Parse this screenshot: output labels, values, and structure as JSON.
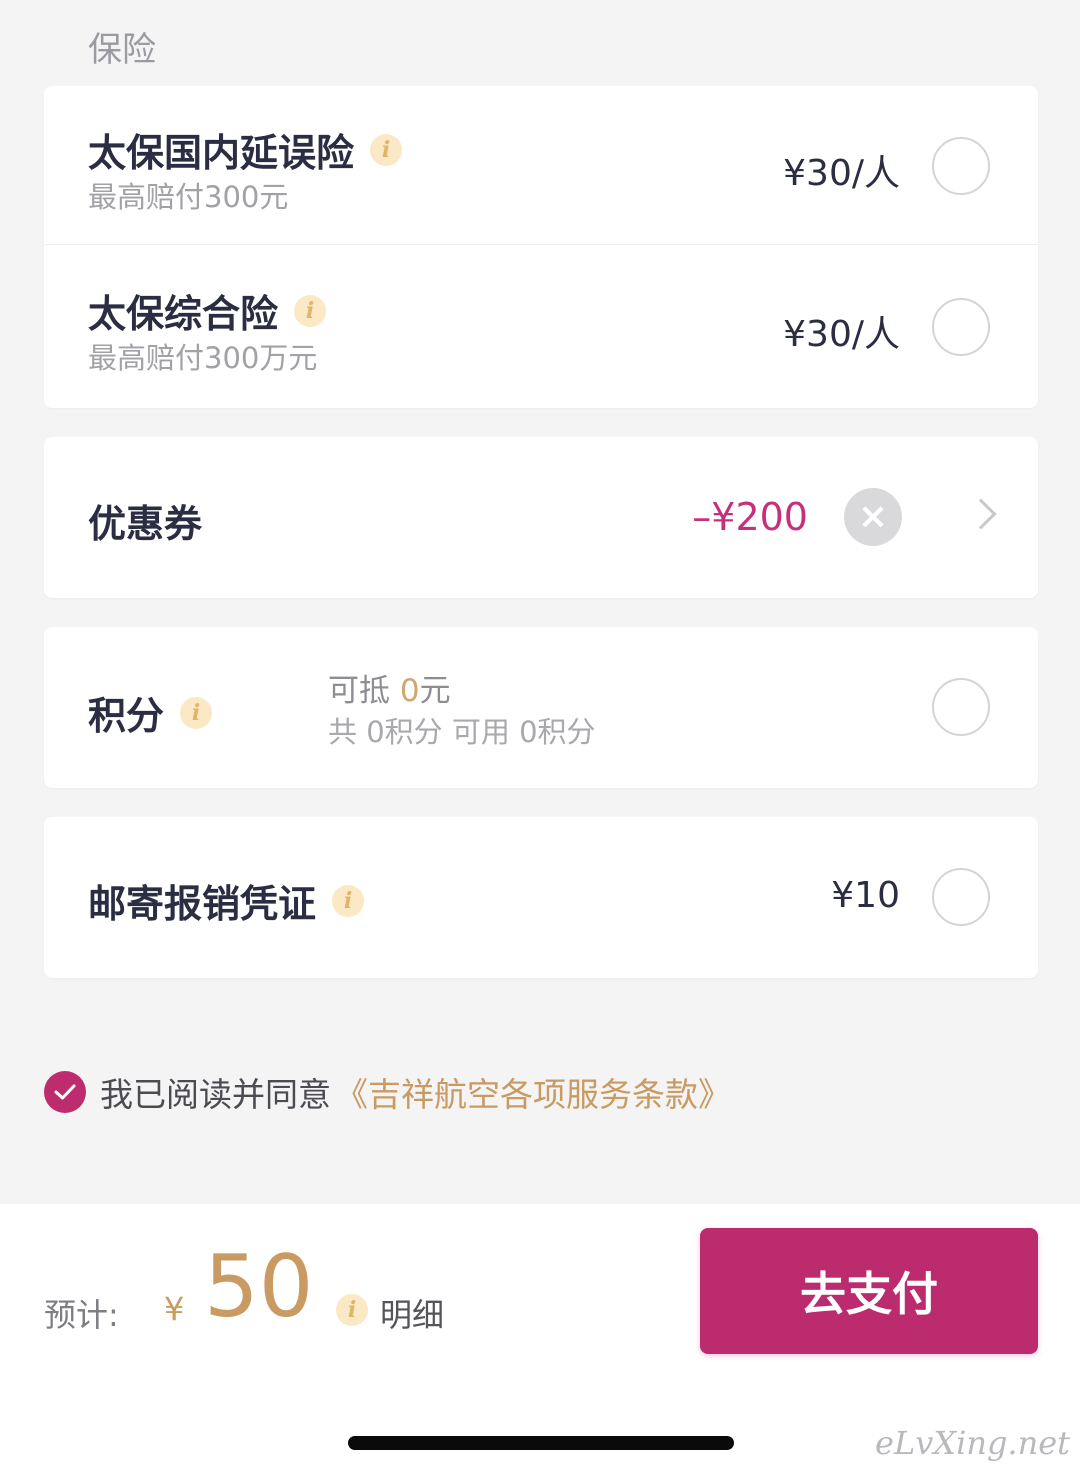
{
  "section_label": "保险",
  "insurance": [
    {
      "title": "太保国内延误险",
      "subtitle": "最高赔付300元",
      "price": "¥30/人",
      "selected": false
    },
    {
      "title": "太保综合险",
      "subtitle": "最高赔付300万元",
      "price": "¥30/人",
      "selected": false
    }
  ],
  "coupon": {
    "label": "优惠券",
    "amount": "–¥200",
    "clear_icon": "close-circle-icon",
    "chevron_icon": "chevron-right-icon"
  },
  "points": {
    "label": "积分",
    "offset_prefix": "可抵 ",
    "offset_value": "0",
    "offset_suffix": "元",
    "summary": "共 0积分 可用 0积分",
    "selected": false
  },
  "mail_invoice": {
    "label": "邮寄报销凭证",
    "price": "¥10",
    "selected": false
  },
  "agreement": {
    "checked": true,
    "text": "我已阅读并同意",
    "link": "《吉祥航空各项服务条款》"
  },
  "bottom": {
    "estimate_label": "预计:",
    "currency": "¥",
    "total": "50",
    "detail_label": "明细",
    "pay_button": "去支付"
  },
  "watermark": "eLvXing.net",
  "colors": {
    "brand": "#bb2b6e",
    "gold": "#c99a62",
    "discount": "#c62f7b",
    "info_bg": "#fbe8c4"
  }
}
